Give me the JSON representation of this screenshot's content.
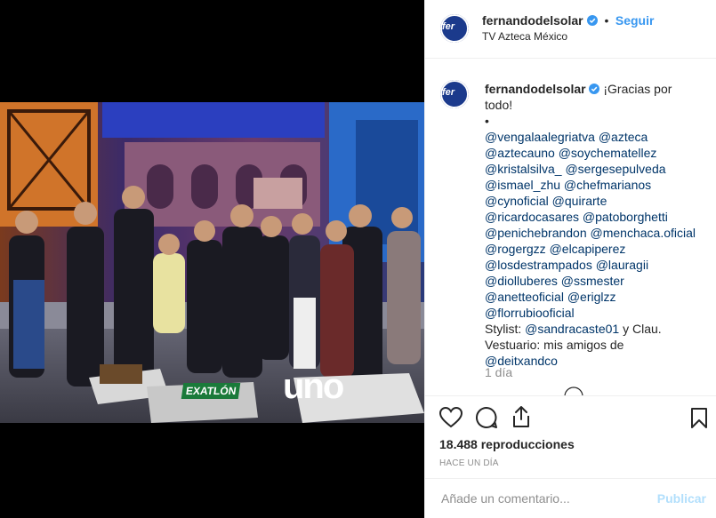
{
  "media": {
    "type": "video",
    "set_signs": [
      "EXATLÓN",
      "uno"
    ]
  },
  "header": {
    "username": "fernandodelsolar",
    "separator": "•",
    "follow_label": "Seguir",
    "location": "TV Azteca México",
    "avatar_text": "fer"
  },
  "caption": {
    "username": "fernandodelsolar",
    "text": "¡Gracias por todo!",
    "bullet": "•",
    "mention_lines": [
      "@vengalaalegriatva @azteca",
      "@aztecauno @soychematellez",
      "@kristalsilva_ @sergesepulveda",
      "@ismael_zhu @chefmarianos",
      "@cynoficial @quirarte",
      "@ricardocasares @patoborghetti",
      "@penichebrandon @menchaca.oficial",
      "@rogergzz @elcapiperez",
      "@losdestrampados @lauragii",
      "@diolluberes @ssmester",
      "@anetteoficial @eriglzz",
      "@florrubiooficial"
    ],
    "stylist_text": "Stylist:",
    "stylist_mention": "@sandracaste01",
    "stylist_suffix": "y Clau.",
    "vestuario_text": "Vestuario: mis amigos de",
    "vestuario_mention": "@deitxandco",
    "time": "1 día"
  },
  "stats": {
    "views": "18.488 reproducciones",
    "posted": "HACE UN DÍA"
  },
  "comment_box": {
    "placeholder": "Añade un comentario...",
    "publish_label": "Publicar"
  },
  "colors": {
    "link": "#3897f0",
    "mention": "#003569",
    "muted": "#8e8e8e",
    "publish_disabled": "#b2dffc",
    "verified": "#3897f0"
  },
  "icons": [
    "heart-icon",
    "comment-icon",
    "share-icon",
    "bookmark-icon",
    "verified-badge-icon"
  ]
}
